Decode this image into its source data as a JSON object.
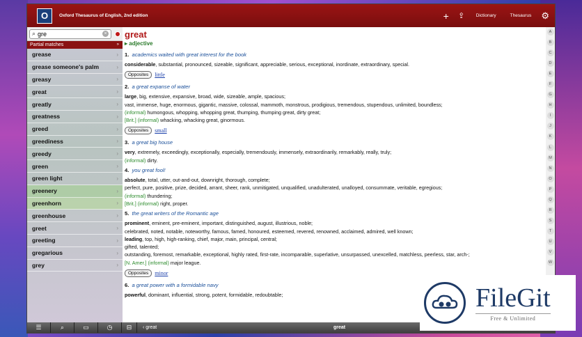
{
  "app": {
    "logo_letter": "O",
    "title": "Oxford Thesaurus of English, 2nd edition"
  },
  "toolbar": {
    "add_icon": "plus-icon",
    "share_icon": "share-icon",
    "dictionary_label": "Dictionary",
    "thesaurus_label": "Thesaurus",
    "settings_icon": "gear-icon"
  },
  "search": {
    "value": "gre",
    "placeholder": ""
  },
  "sidebar": {
    "section_label": "Partial matches",
    "section_arrow": "»",
    "items": [
      {
        "label": "grease"
      },
      {
        "label": "grease someone's palm"
      },
      {
        "label": "greasy"
      },
      {
        "label": "great"
      },
      {
        "label": "greatly"
      },
      {
        "label": "greatness"
      },
      {
        "label": "greed"
      },
      {
        "label": "greediness"
      },
      {
        "label": "greedy"
      },
      {
        "label": "green"
      },
      {
        "label": "green light"
      },
      {
        "label": "greenery"
      },
      {
        "label": "greenhorn"
      },
      {
        "label": "greenhouse"
      },
      {
        "label": "greet"
      },
      {
        "label": "greeting"
      },
      {
        "label": "gregarious"
      },
      {
        "label": "grey"
      }
    ]
  },
  "entry": {
    "headword": "great",
    "pos": "adjective",
    "senses": [
      {
        "num": "1.",
        "example": "academics waited with great interest for the book",
        "lines": [
          {
            "core": "considerable",
            "rest": ", substantial, pronounced, sizeable, significant, appreciable, serious, exceptional, inordinate, extraordinary, special."
          }
        ],
        "opposite": "little"
      },
      {
        "num": "2.",
        "example": "a great expanse of water",
        "lines": [
          {
            "core": "large",
            "rest": ", big, extensive, expansive, broad, wide, sizeable, ample, spacious;"
          },
          {
            "core": "",
            "rest": "vast, immense, huge, enormous, gigantic, massive, colossal, mammoth, monstrous, prodigious, tremendous, stupendous, unlimited, boundless;"
          },
          {
            "reg": "(informal)",
            "rest": " humongous, whopping, whopping great, thumping, thumping great, dirty great;"
          },
          {
            "reg": "[Brit.] (informal)",
            "rest": " whacking, whacking great, ginormous."
          }
        ],
        "opposite": "small"
      },
      {
        "num": "3.",
        "example": "a great big house",
        "lines": [
          {
            "core": "very",
            "rest": ", extremely, exceedingly, exceptionally, especially, tremendously, immensely, extraordinarily, remarkably, really, truly;"
          },
          {
            "reg": "(informal)",
            "rest": " dirty."
          }
        ]
      },
      {
        "num": "4.",
        "example": "you great fool!",
        "lines": [
          {
            "core": "absolute",
            "rest": ", total, utter, out-and-out, downright, thorough, complete;"
          },
          {
            "core": "",
            "rest": "perfect, pure, positive, prize, decided, arrant, sheer, rank, unmitigated, unqualified, unadulterated, unalloyed, consummate, veritable, egregious;"
          },
          {
            "reg": "(informal)",
            "rest": " thundering;"
          },
          {
            "reg": "[Brit.] (informal)",
            "rest": " right, proper."
          }
        ]
      },
      {
        "num": "5.",
        "example": "the great writers of the Romantic age",
        "lines": [
          {
            "core": "prominent",
            "rest": ", eminent, pre-eminent, important, distinguished, august, illustrious, noble;"
          },
          {
            "core": "",
            "rest": "celebrated, noted, notable, noteworthy, famous, famed, honoured, esteemed, revered, renowned, acclaimed, admired, well known;"
          },
          {
            "core": "leading",
            "rest": ", top, high, high-ranking, chief, major, main, principal, central;"
          },
          {
            "core": "",
            "rest": "gifted, talented;"
          },
          {
            "core": "",
            "rest": "outstanding, foremost, remarkable, exceptional, highly rated, first-rate, incomparable, superlative, unsurpassed, unexcelled, matchless, peerless, star, arch-;"
          },
          {
            "reg": "[N. Amer.] (informal)",
            "rest": " major league."
          }
        ],
        "opposite": "minor"
      },
      {
        "num": "6.",
        "example": "a great power with a formidable navy",
        "lines": [
          {
            "core": "powerful",
            "rest": ", dominant, influential, strong, potent, formidable, redoubtable;"
          }
        ]
      }
    ],
    "opposites_label": "Opposites"
  },
  "alphabet": [
    "A",
    "B",
    "C",
    "D",
    "E",
    "F",
    "G",
    "H",
    "I",
    "J",
    "K",
    "L",
    "M",
    "N",
    "O",
    "P",
    "Q",
    "R",
    "S",
    "T",
    "U",
    "V",
    "W"
  ],
  "bottom": {
    "back_label": "great",
    "current_word": "great"
  },
  "watermark": {
    "title": "FileGit",
    "subtitle": "Free & Unlimited"
  }
}
